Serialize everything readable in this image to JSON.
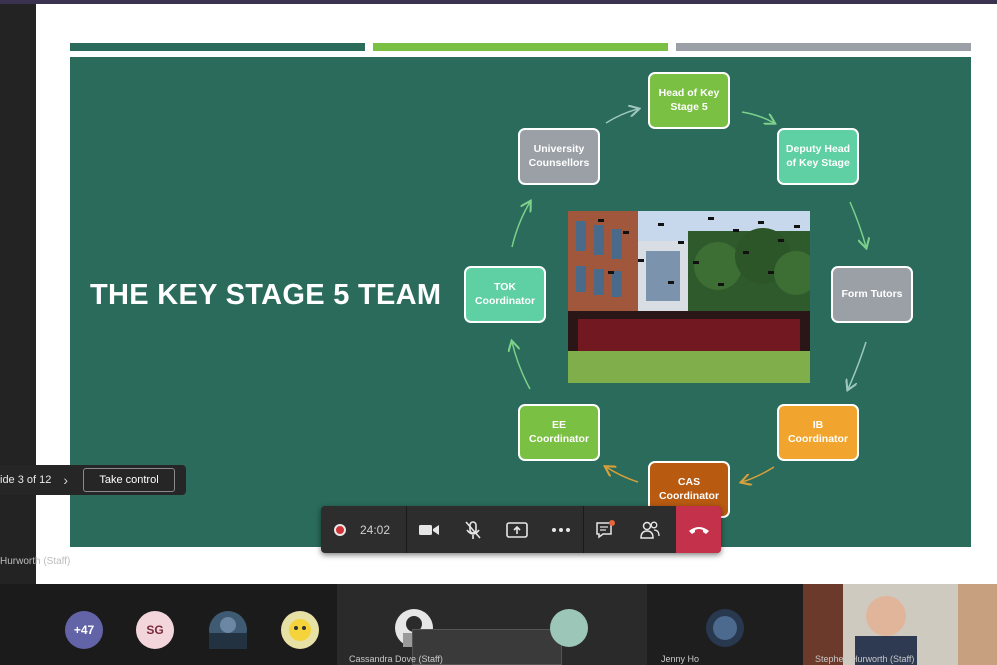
{
  "slide": {
    "title": "THE KEY STAGE 5 TEAM",
    "nodes": [
      {
        "label": "Head of Key Stage 5",
        "color": "#7ac043"
      },
      {
        "label": "Deputy Head of Key Stage",
        "color": "#5ed0a3"
      },
      {
        "label": "Form Tutors",
        "color": "#9aa0a6"
      },
      {
        "label": "IB Coordinator",
        "color": "#f2a52e"
      },
      {
        "label": "CAS Coordinator",
        "color": "#b85a10"
      },
      {
        "label": "EE Coordinator",
        "color": "#7ac043"
      },
      {
        "label": "TOK Coordinator",
        "color": "#5ed0a3"
      },
      {
        "label": "University Counsellors",
        "color": "#9aa0a6"
      }
    ],
    "accent_colors": [
      "#2a6b5b",
      "#7ac043",
      "#9aa0a6"
    ]
  },
  "share": {
    "slide_counter": "ide 3 of 12",
    "take_control_label": "Take control",
    "presenter_name": "Hurworth (Staff)"
  },
  "call_controls": {
    "timer": "24:02",
    "icons": [
      "record-icon",
      "camera-icon",
      "mic-off-icon",
      "share-screen-icon",
      "more-icon",
      "chat-icon",
      "participants-icon",
      "hangup-icon"
    ],
    "hangup_color": "#c4314b"
  },
  "participants": {
    "overflow": "+47",
    "initials": "SG",
    "names": [
      "Cassandra Dove (Staff)",
      "Jenny Ho",
      "Stephen Hurworth (Staff)"
    ]
  }
}
